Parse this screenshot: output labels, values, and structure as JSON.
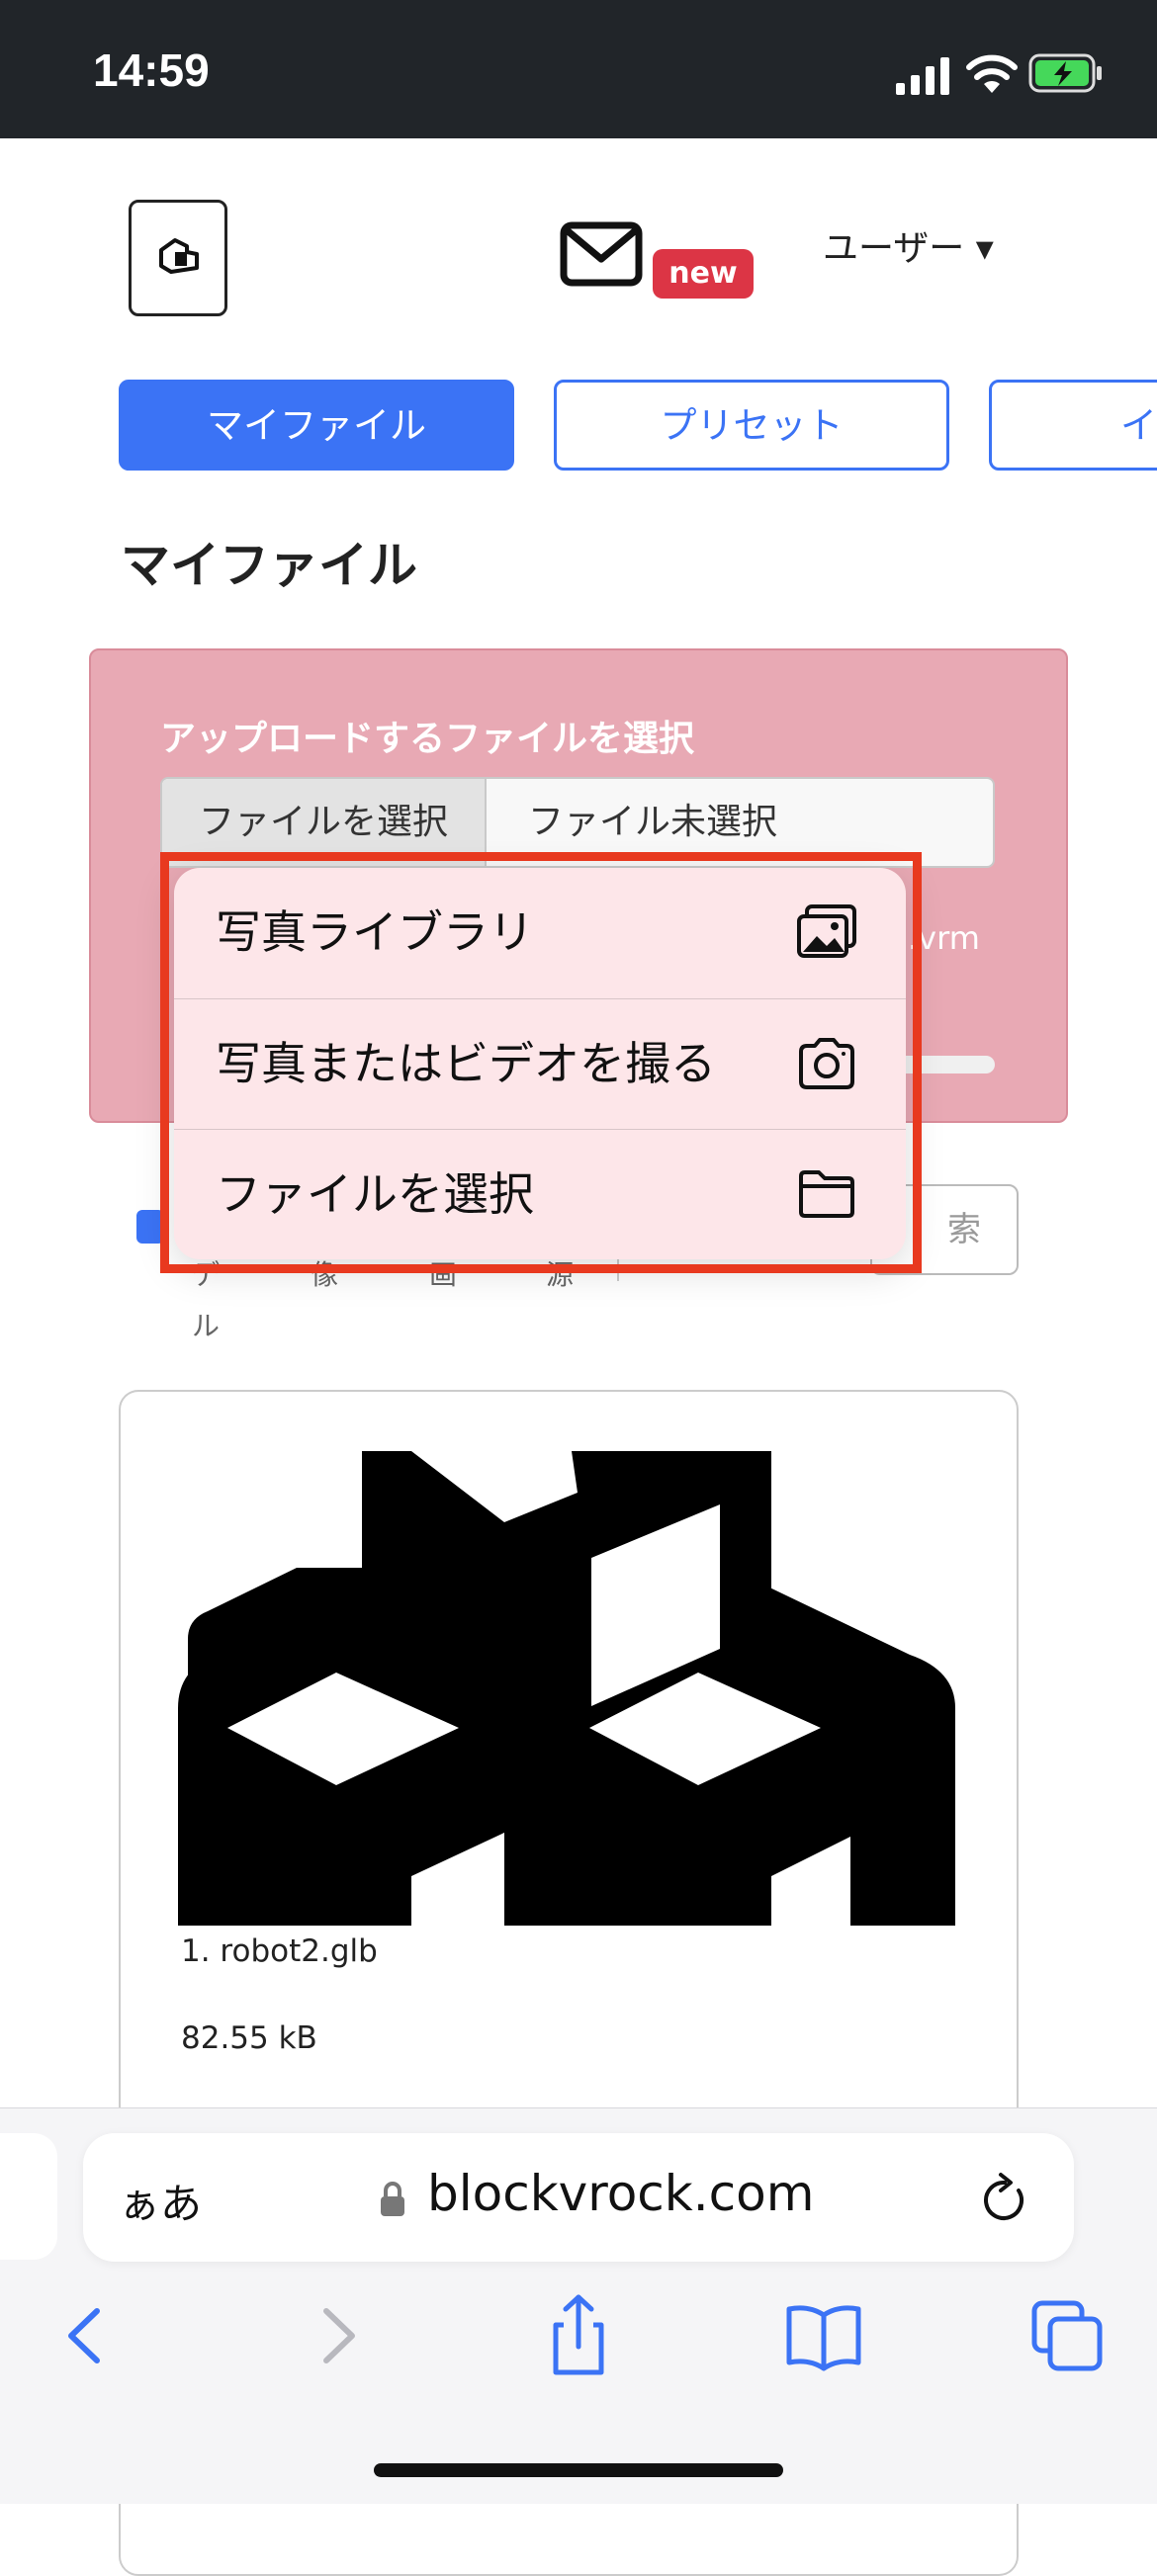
{
  "status_bar": {
    "time": "14:59"
  },
  "header": {
    "new_badge": "new",
    "user_menu": "ユーザー ▾"
  },
  "tabs": [
    {
      "label": "マイファイル",
      "active": true
    },
    {
      "label": "プリセット",
      "active": false
    },
    {
      "label": "イ",
      "active": false
    }
  ],
  "page_title": "マイファイル",
  "upload": {
    "label": "アップロードするファイルを選択",
    "choose_button": "ファイルを選択",
    "no_file": "ファイル未選択",
    "accepted_ext": ".vrm"
  },
  "filters": {
    "search_partial": "索",
    "truncated_labels": [
      "デ",
      "像",
      "画",
      "源"
    ],
    "truncated_second_line": "ル"
  },
  "popup_menu": {
    "items": [
      {
        "label": "写真ライブラリ",
        "icon": "photo-library-icon"
      },
      {
        "label": "写真またはビデオを撮る",
        "icon": "camera-icon"
      },
      {
        "label": "ファイルを選択",
        "icon": "folder-icon"
      }
    ],
    "highlight_color": "#e8391f"
  },
  "file_item": {
    "name": "1. robot2.glb",
    "size": "82.55 kB"
  },
  "safari": {
    "aa": "ぁあ",
    "domain": "blockvrock.com"
  },
  "colors": {
    "accent": "#3b73f5",
    "badge": "#dc3545",
    "upload_card": "#e8a9b4"
  }
}
